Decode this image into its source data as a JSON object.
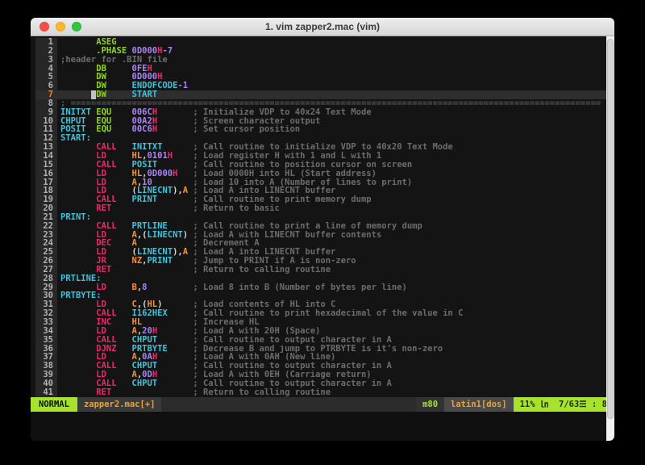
{
  "window": {
    "title": "1. vim zapper2.mac (vim)"
  },
  "colors": {
    "background": "#141414",
    "gutter_bg": "#272727",
    "cursorline_bg": "#2e2e2e",
    "directive": "#8fd41f",
    "mnemonic": "#f0256b",
    "symbol": "#3fc3da",
    "register": "#f19336",
    "number": "#a984f5",
    "plain": "#d8d8d8",
    "comment": "#6c6c6c",
    "current_line_number": "#e8863c",
    "mode_bg": "#a6e22e",
    "filename_fg": "#e8a33d"
  },
  "editor": {
    "lines": [
      {
        "n": 1,
        "op": [
          "ASEG",
          "dir"
        ]
      },
      {
        "n": 2,
        "op": [
          ".PHASE",
          "dir"
        ],
        "ops": [
          [
            "0D000",
            "num"
          ],
          [
            "H",
            "kw"
          ],
          [
            "-7",
            "num"
          ]
        ]
      },
      {
        "n": 3,
        "full": [
          ";header for .BIN file",
          "cmt"
        ]
      },
      {
        "n": 4,
        "op": [
          "DB",
          "dir"
        ],
        "ops": [
          [
            "0FE",
            "num"
          ],
          [
            "H",
            "kw"
          ]
        ]
      },
      {
        "n": 5,
        "op": [
          "DW",
          "dir"
        ],
        "ops": [
          [
            "0D000",
            "num"
          ],
          [
            "H",
            "kw"
          ]
        ]
      },
      {
        "n": 6,
        "op": [
          "DW",
          "dir"
        ],
        "ops": [
          [
            "ENDOFCODE",
            "sym"
          ],
          [
            "-1",
            "num"
          ]
        ]
      },
      {
        "n": 7,
        "cur": true,
        "op": [
          "DW",
          "dir"
        ],
        "ops": [
          [
            "START",
            "sym"
          ]
        ]
      },
      {
        "n": 8,
        "full": [
          "; ========================================================================================================",
          "sep"
        ]
      },
      {
        "n": 9,
        "label": [
          "INITXT",
          "sym"
        ],
        "op": [
          "EQU",
          "dir"
        ],
        "ops": [
          [
            "006C",
            "num"
          ],
          [
            "H",
            "kw"
          ]
        ],
        "cmt": "; Initialize VDP to 40x24 Text Mode"
      },
      {
        "n": 10,
        "label": [
          "CHPUT",
          "sym"
        ],
        "op": [
          "EQU",
          "dir"
        ],
        "ops": [
          [
            "00A2",
            "num"
          ],
          [
            "H",
            "kw"
          ]
        ],
        "cmt": "; Screen character output"
      },
      {
        "n": 11,
        "label": [
          "POSIT",
          "sym"
        ],
        "op": [
          "EQU",
          "dir"
        ],
        "ops": [
          [
            "00C6",
            "num"
          ],
          [
            "H",
            "kw"
          ]
        ],
        "cmt": "; Set cursor position"
      },
      {
        "n": 12,
        "label": [
          "START:",
          "sym"
        ]
      },
      {
        "n": 13,
        "op": [
          "CALL",
          "kw"
        ],
        "ops": [
          [
            "INITXT",
            "sym"
          ]
        ],
        "cmt": "; Call routine to initialize VDP to 40x20 Text Mode"
      },
      {
        "n": 14,
        "op": [
          "LD",
          "kw"
        ],
        "ops": [
          [
            "HL",
            "reg"
          ],
          [
            ",",
            "pln"
          ],
          [
            "0101",
            "num"
          ],
          [
            "H",
            "kw"
          ]
        ],
        "cmt": "; Load register H with 1 and L with 1"
      },
      {
        "n": 15,
        "op": [
          "CALL",
          "kw"
        ],
        "ops": [
          [
            "POSIT",
            "sym"
          ]
        ],
        "cmt": "; Call routine to position cursor on screen"
      },
      {
        "n": 16,
        "op": [
          "LD",
          "kw"
        ],
        "ops": [
          [
            "HL",
            "reg"
          ],
          [
            ",",
            "pln"
          ],
          [
            "0D000",
            "num"
          ],
          [
            "H",
            "kw"
          ]
        ],
        "cmt": "; Load 0000H into HL (Start address)"
      },
      {
        "n": 17,
        "op": [
          "LD",
          "kw"
        ],
        "ops": [
          [
            "A",
            "reg"
          ],
          [
            ",",
            "pln"
          ],
          [
            "10",
            "num"
          ]
        ],
        "cmt": "; Load 10 into A (Number of lines to print)"
      },
      {
        "n": 18,
        "op": [
          "LD",
          "kw"
        ],
        "ops": [
          [
            "(",
            "pln"
          ],
          [
            "LINECNT",
            "sym"
          ],
          [
            ")",
            "pln"
          ],
          [
            ",",
            "pln"
          ],
          [
            "A",
            "reg"
          ]
        ],
        "cmt": "; Load A into LINECNT buffer"
      },
      {
        "n": 19,
        "op": [
          "CALL",
          "kw"
        ],
        "ops": [
          [
            "PRINT",
            "sym"
          ]
        ],
        "cmt": "; Call routine to print memory dump"
      },
      {
        "n": 20,
        "op": [
          "RET",
          "kw"
        ],
        "cmt": "; Return to basic"
      },
      {
        "n": 21,
        "label": [
          "PRINT:",
          "sym"
        ]
      },
      {
        "n": 22,
        "op": [
          "CALL",
          "kw"
        ],
        "ops": [
          [
            "PRTLINE",
            "sym"
          ]
        ],
        "cmt": "; Call routine to print a line of memory dump"
      },
      {
        "n": 23,
        "op": [
          "LD",
          "kw"
        ],
        "ops": [
          [
            "A",
            "reg"
          ],
          [
            ",",
            "pln"
          ],
          [
            "(",
            "pln"
          ],
          [
            "LINECNT",
            "sym"
          ],
          [
            ")",
            "pln"
          ]
        ],
        "cmt": "; Load A with LINECNT buffer contents"
      },
      {
        "n": 24,
        "op": [
          "DEC",
          "kw"
        ],
        "ops": [
          [
            "A",
            "reg"
          ]
        ],
        "cmt": "; Decrement A"
      },
      {
        "n": 25,
        "op": [
          "LD",
          "kw"
        ],
        "ops": [
          [
            "(",
            "pln"
          ],
          [
            "LINECNT",
            "sym"
          ],
          [
            ")",
            "pln"
          ],
          [
            ",",
            "pln"
          ],
          [
            "A",
            "reg"
          ]
        ],
        "cmt": "; Load A into LINECNT buffer"
      },
      {
        "n": 26,
        "op": [
          "JR",
          "kw"
        ],
        "ops": [
          [
            "NZ",
            "reg"
          ],
          [
            ",",
            "pln"
          ],
          [
            "PRINT",
            "sym"
          ]
        ],
        "cmt": "; Jump to PRINT if A is non-zero"
      },
      {
        "n": 27,
        "op": [
          "RET",
          "kw"
        ],
        "cmt": "; Return to calling routine"
      },
      {
        "n": 28,
        "label": [
          "PRTLINE:",
          "sym"
        ]
      },
      {
        "n": 29,
        "op": [
          "LD",
          "kw"
        ],
        "ops": [
          [
            "B",
            "reg"
          ],
          [
            ",",
            "pln"
          ],
          [
            "8",
            "num"
          ]
        ],
        "cmt": "; Load 8 into B (Number of bytes per line)"
      },
      {
        "n": 30,
        "label": [
          "PRTBYTE:",
          "sym"
        ]
      },
      {
        "n": 31,
        "op": [
          "LD",
          "kw"
        ],
        "ops": [
          [
            "C",
            "reg"
          ],
          [
            ",",
            "pln"
          ],
          [
            "(",
            "pln"
          ],
          [
            "HL",
            "reg"
          ],
          [
            ")",
            "pln"
          ]
        ],
        "cmt": "; Load contents of HL into C"
      },
      {
        "n": 32,
        "op": [
          "CALL",
          "kw"
        ],
        "ops": [
          [
            "I162HEX",
            "sym"
          ]
        ],
        "cmt": "; Call routine to print hexadecimal of the value in C"
      },
      {
        "n": 33,
        "op": [
          "INC",
          "kw"
        ],
        "ops": [
          [
            "HL",
            "reg"
          ]
        ],
        "cmt": "; Increase HL"
      },
      {
        "n": 34,
        "op": [
          "LD",
          "kw"
        ],
        "ops": [
          [
            "A",
            "reg"
          ],
          [
            ",",
            "pln"
          ],
          [
            "20",
            "num"
          ],
          [
            "H",
            "kw"
          ]
        ],
        "cmt": "; Load A with 20H (Space)"
      },
      {
        "n": 35,
        "op": [
          "CALL",
          "kw"
        ],
        "ops": [
          [
            "CHPUT",
            "sym"
          ]
        ],
        "cmt": "; Call routine to output character in A"
      },
      {
        "n": 36,
        "op": [
          "DJNZ",
          "kw"
        ],
        "ops": [
          [
            "PRTBYTE",
            "sym"
          ]
        ],
        "cmt": "; Decrease B and jump to PTRBYTE is it's non-zero"
      },
      {
        "n": 37,
        "op": [
          "LD",
          "kw"
        ],
        "ops": [
          [
            "A",
            "reg"
          ],
          [
            ",",
            "pln"
          ],
          [
            "0A",
            "num"
          ],
          [
            "H",
            "kw"
          ]
        ],
        "cmt": "; Load A with 0AH (New line)"
      },
      {
        "n": 38,
        "op": [
          "CALL",
          "kw"
        ],
        "ops": [
          [
            "CHPUT",
            "sym"
          ]
        ],
        "cmt": "; Call routine to output character in A"
      },
      {
        "n": 39,
        "op": [
          "LD",
          "kw"
        ],
        "ops": [
          [
            "A",
            "reg"
          ],
          [
            ",",
            "pln"
          ],
          [
            "0D",
            "num"
          ],
          [
            "H",
            "kw"
          ]
        ],
        "cmt": "; Load A with 0EH (Carriage return)"
      },
      {
        "n": 40,
        "op": [
          "CALL",
          "kw"
        ],
        "ops": [
          [
            "CHPUT",
            "sym"
          ]
        ],
        "cmt": "; Call routine to output character in A"
      },
      {
        "n": 41,
        "op": [
          "RET",
          "kw"
        ],
        "cmt": "; Return to calling routine"
      }
    ]
  },
  "statusbar": {
    "mode": "NORMAL",
    "file": "zapper2.mac[+]",
    "filetype": "m80",
    "encoding": "latin1[dos]",
    "position_info": "11% ㏑  7/63☰ : 8"
  }
}
